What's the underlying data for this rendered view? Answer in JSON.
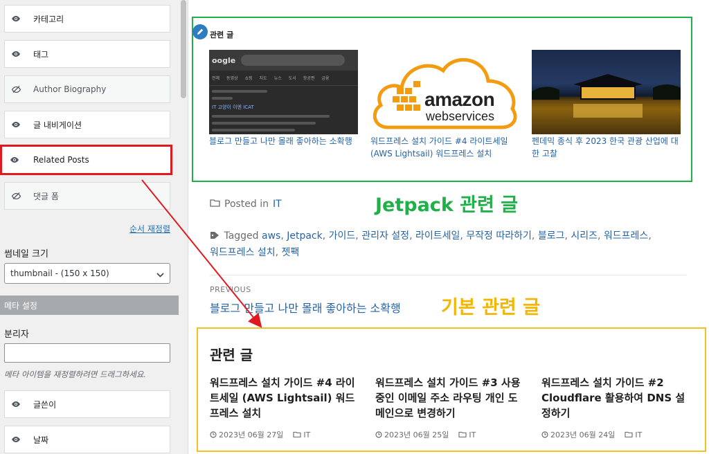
{
  "sidebar": {
    "items": [
      {
        "label": "카테고리",
        "visible": true
      },
      {
        "label": "태그",
        "visible": true
      },
      {
        "label": "Author Biography",
        "visible": false
      },
      {
        "label": "글 내비게이션",
        "visible": true
      },
      {
        "label": "Related Posts",
        "visible": true,
        "highlighted": true
      },
      {
        "label": "댓글 폼",
        "visible": false
      }
    ],
    "reorder_link": "순서 재정렬",
    "thumbnail_label": "썸네일 크기",
    "thumbnail_value": "thumbnail - (150 x 150)",
    "meta_header": "메타 설정",
    "separator_label": "분리자",
    "separator_value": "",
    "meta_help": "메타 아이템을 재정렬하려면 드래그하세요.",
    "meta_items": [
      {
        "label": "글쓴이",
        "visible": true
      },
      {
        "label": "날짜",
        "visible": true
      }
    ]
  },
  "jetpack": {
    "heading": "관련 글",
    "label": "Jetpack 관련 글",
    "cards": [
      {
        "title": "블로그 만들고 나만 몰래 좋아하는 소확행",
        "image": "google-search-screenshot"
      },
      {
        "title": "워드프레스 설치 가이드 #4 라이트세일 (AWS Lightsail) 워드프레스 설치",
        "image": "amazon-web-services-logo",
        "logo_top": "amazon",
        "logo_bottom": "webservices"
      },
      {
        "title": "펜데믹 종식 후 2023 한국 관광 산업에 대한 고찰",
        "image": "night-palace-photo"
      }
    ],
    "google_image": {
      "logo": "oogle",
      "tabs": [
        "전체",
        "동영상",
        "쇼핑",
        "지도",
        "뉴스",
        "도서",
        "항공편",
        "금융"
      ],
      "result_link": "IT 고양이 이엔 ICAT"
    }
  },
  "post_meta": {
    "posted_prefix": "Posted in",
    "category": "IT",
    "tagged_prefix": "Tagged",
    "tags": [
      "aws",
      "Jetpack",
      "가이드",
      "관리자 설정",
      "라이트세일",
      "무작정 따라하기",
      "블로그",
      "시리즈",
      "워드프레스",
      "워드프레스 설치",
      "젯팩"
    ]
  },
  "navigation": {
    "previous_label": "PREVIOUS",
    "previous_title": "블로그 만들고 나만 몰래 좋아하는 소확행"
  },
  "basic_related": {
    "label": "기본 관련 글",
    "heading": "관련 글",
    "cards": [
      {
        "title": "워드프레스 설치 가이드 #4 라이트세일 (AWS Lightsail) 워드프레스 설치",
        "date": "2023년 06월 27일",
        "category": "IT"
      },
      {
        "title": "워드프레스 설치 가이드 #3 사용중인 이메일 주소 라우팅 개인 도메인으로 변경하기",
        "date": "2023년 06월 25일",
        "category": "IT"
      },
      {
        "title": "워드프레스 설치 가이드 #2 Cloudflare 활용하여 DNS 설정하기",
        "date": "2023년 06월 24일",
        "category": "IT"
      }
    ]
  },
  "colors": {
    "jetpack_box": "#1fb04a",
    "basic_box": "#f2c124",
    "highlight": "#e0191f",
    "link": "#2563a6"
  }
}
